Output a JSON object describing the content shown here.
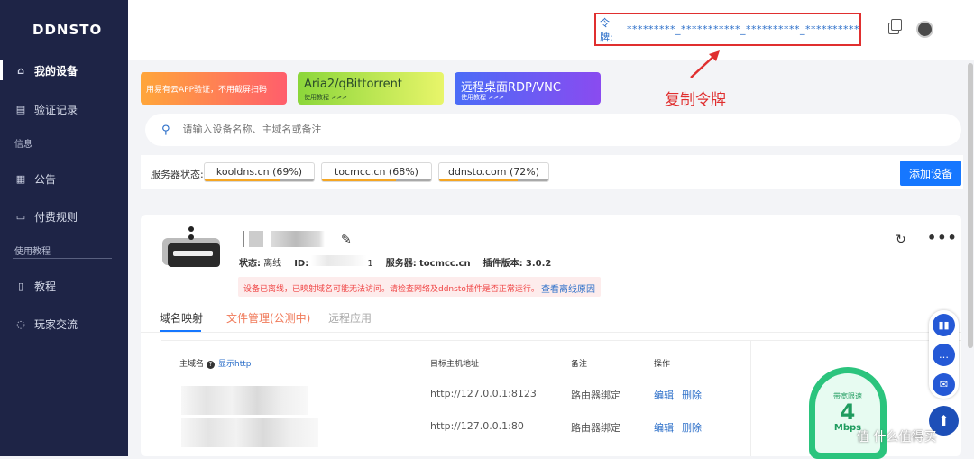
{
  "app": {
    "logo": "DDNSTO"
  },
  "sidebar": {
    "items": [
      {
        "label": "我的设备",
        "icon": "home-icon"
      },
      {
        "label": "验证记录",
        "icon": "document-icon"
      },
      {
        "label": "公告",
        "icon": "calendar-icon"
      },
      {
        "label": "付费规则",
        "icon": "card-icon"
      },
      {
        "label": "教程",
        "icon": "book-icon"
      },
      {
        "label": "玩家交流",
        "icon": "chat-icon"
      }
    ],
    "section_info": "信息",
    "section_tutorial": "使用教程"
  },
  "header": {
    "token_label": "令牌:",
    "token_value": "*********_***********_**********_**********",
    "copy_icon": "copy-icon",
    "avatar_icon": "avatar-icon"
  },
  "annotation": {
    "text": "复制令牌",
    "color": "#e02f2f"
  },
  "banners": [
    {
      "title": "用易有云APP验证，不用截屏扫码",
      "sub": ""
    },
    {
      "title": "Aria2/qBittorrent",
      "sub": "使用教程 >>>"
    },
    {
      "title": "远程桌面RDP/VNC",
      "sub": "使用教程 >>>"
    }
  ],
  "search": {
    "placeholder": "请输入设备名称、主域名或备注"
  },
  "server_status": {
    "label": "服务器状态:",
    "servers": [
      {
        "name": "kooldns.cn (69%)",
        "percent": 0.69
      },
      {
        "name": "tocmcc.cn (68%)",
        "percent": 0.68
      },
      {
        "name": "ddnsto.com (72%)",
        "percent": 0.72
      }
    ],
    "add_button": "添加设备"
  },
  "device": {
    "status_label": "状态:",
    "status_value": "离线",
    "id_label": "ID:",
    "id_value": "1",
    "server_label": "服务器:",
    "server_value": "tocmcc.cn",
    "plugin_label": "插件版本:",
    "plugin_value": "3.0.2",
    "warning": "设备已离线，已映射域名可能无法访问。请检查网络及ddnsto插件是否正常运行。",
    "warning_link": "查看离线原因"
  },
  "tabs": [
    {
      "label": "域名映射"
    },
    {
      "label": "文件管理(公测中)"
    },
    {
      "label": "远程应用"
    }
  ],
  "table": {
    "headers": {
      "domain": "主域名",
      "show_http": "显示http",
      "target": "目标主机地址",
      "note": "备注",
      "action": "操作"
    },
    "rows": [
      {
        "target": "http://127.0.0.1:8123",
        "note": "路由器绑定",
        "edit": "编辑",
        "delete": "删除"
      },
      {
        "target": "http://127.0.0.1:80",
        "note": "路由器绑定",
        "edit": "编辑",
        "delete": "删除"
      }
    ]
  },
  "speed": {
    "label": "带宽限速",
    "value": "4",
    "unit": "Mbps"
  },
  "watermark": "值 什么值得买"
}
